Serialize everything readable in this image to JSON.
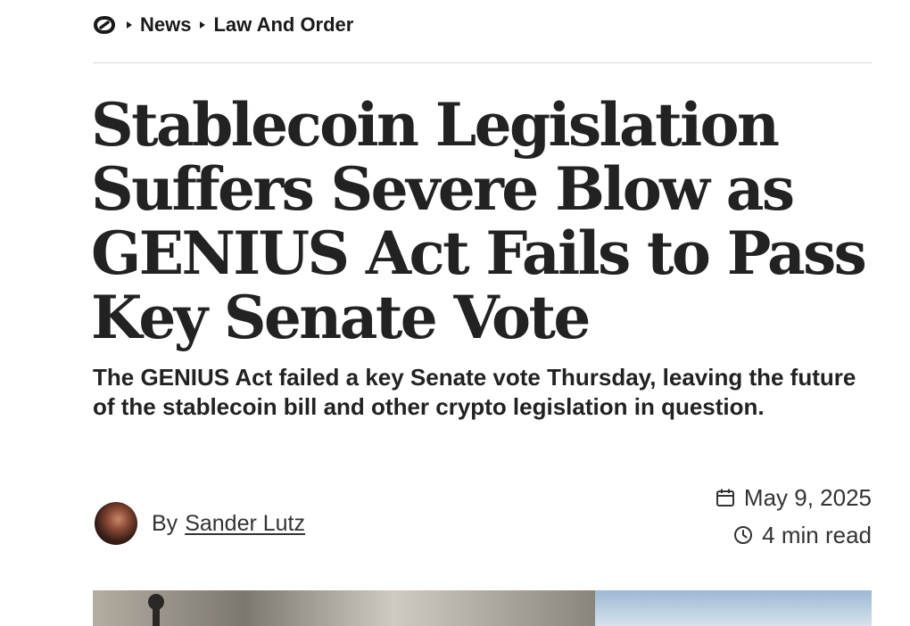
{
  "breadcrumb": {
    "logo_icon": "publication-logo-icon",
    "items": [
      "News",
      "Law And Order"
    ]
  },
  "article": {
    "headline": "Stablecoin Legislation Suffers Severe Blow as GENIUS Act Fails to Pass Key Senate Vote",
    "dek": "The GENIUS Act failed a key Senate vote Thursday, leaving the future of the stablecoin bill and other crypto legislation in question.",
    "byline_prefix": "By",
    "author": "Sander Lutz",
    "date": "May 9, 2025",
    "read_time": "4 min read"
  },
  "icons": {
    "calendar": "calendar-icon",
    "clock": "clock-icon"
  },
  "colors": {
    "text": "#222222",
    "divider": "#d9d9d9"
  }
}
